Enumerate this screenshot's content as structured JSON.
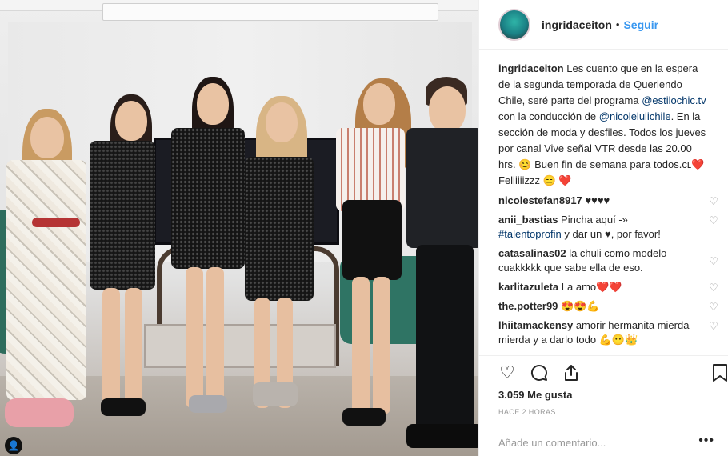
{
  "post": {
    "username": "ingridaceiton",
    "follow_label": "Seguir",
    "separator": "•",
    "caption_user": "ingridaceiton",
    "caption_part1": " Les cuento que en la espera de la segunda temporada de Queriendo Chile, seré parte del programa ",
    "caption_link1": "@estilochic.tv",
    "caption_part2": " con la conducción de ",
    "caption_link2": "@nicolelulichile",
    "caption_part3": ". En la sección de moda y desfiles. Todos los jueves por canal Vive señal VTR desde las 20.00 hrs. 😊 Buen fin de semana para todos.ᴄʟ❤️ Feliiiiizzz 😑 ❤️",
    "likes": "3.059 Me gusta",
    "time": "HACE 2 HORAS",
    "comment_placeholder": "Añade un comentario...",
    "more_label": "•••"
  },
  "comments": [
    {
      "user": "nicolestefan8917",
      "text": " ♥♥♥♥"
    },
    {
      "user": "anii_bastias",
      "text": " Pincha aquí -» ",
      "link": "#talentoprofin",
      "text2": " y dar un ♥, por favor!"
    },
    {
      "user": "catasalinas02",
      "text": " la chuli como modelo cuakkkkk que sabe ella de eso."
    },
    {
      "user": "karlitazuleta",
      "text": " La amo❤️❤️"
    },
    {
      "user": "the.potter99",
      "text": " 😍😍💪"
    },
    {
      "user": "lhiitamackensy",
      "text": " amorir hermanita mierda mierda y a darlo todo 💪😶👑"
    }
  ],
  "icons": {
    "like": "heart-icon",
    "comment": "comment-icon",
    "share": "share-icon",
    "save": "bookmark-icon",
    "comment_like": "heart-outline-icon"
  },
  "colors": {
    "link": "#003569",
    "follow": "#3897f0",
    "text": "#262626",
    "muted": "#999999"
  }
}
